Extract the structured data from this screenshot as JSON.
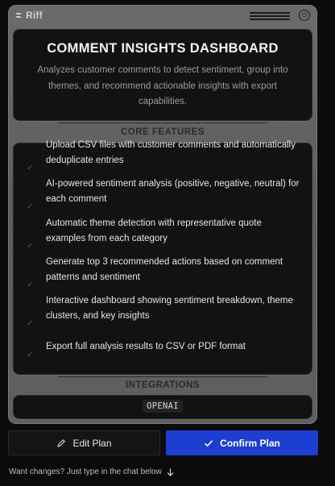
{
  "app": {
    "brand": "Riff"
  },
  "header": {
    "title": "COMMENT INSIGHTS DASHBOARD",
    "description": "Analyzes customer comments to detect sentiment, group into themes, and recommend actionable insights with export capabilities."
  },
  "sections": {
    "core_features": "CORE FEATURES",
    "integrations": "INTEGRATIONS"
  },
  "features": [
    "Upload CSV files with customer comments and automatically deduplicate entries",
    "AI-powered sentiment analysis (positive, negative, neutral) for each comment",
    "Automatic theme detection with representative quote examples from each category",
    "Generate top 3 recommended actions based on comment patterns and sentiment",
    "Interactive dashboard showing sentiment breakdown, theme clusters, and key insights",
    "Export full analysis results to CSV or PDF format"
  ],
  "integrations": [
    "OPENAI"
  ],
  "actions": {
    "edit_label": "Edit Plan",
    "confirm_label": "Confirm Plan"
  },
  "hint": "Want changes? Just type in the chat below",
  "colors": {
    "accent": "#1c3fd1",
    "background": "#0b0b0c",
    "device": "#5f5f62"
  },
  "icons": [
    "riff-logo-icon",
    "power-icon",
    "check-icon",
    "pencil-icon",
    "arrow-down-icon"
  ]
}
